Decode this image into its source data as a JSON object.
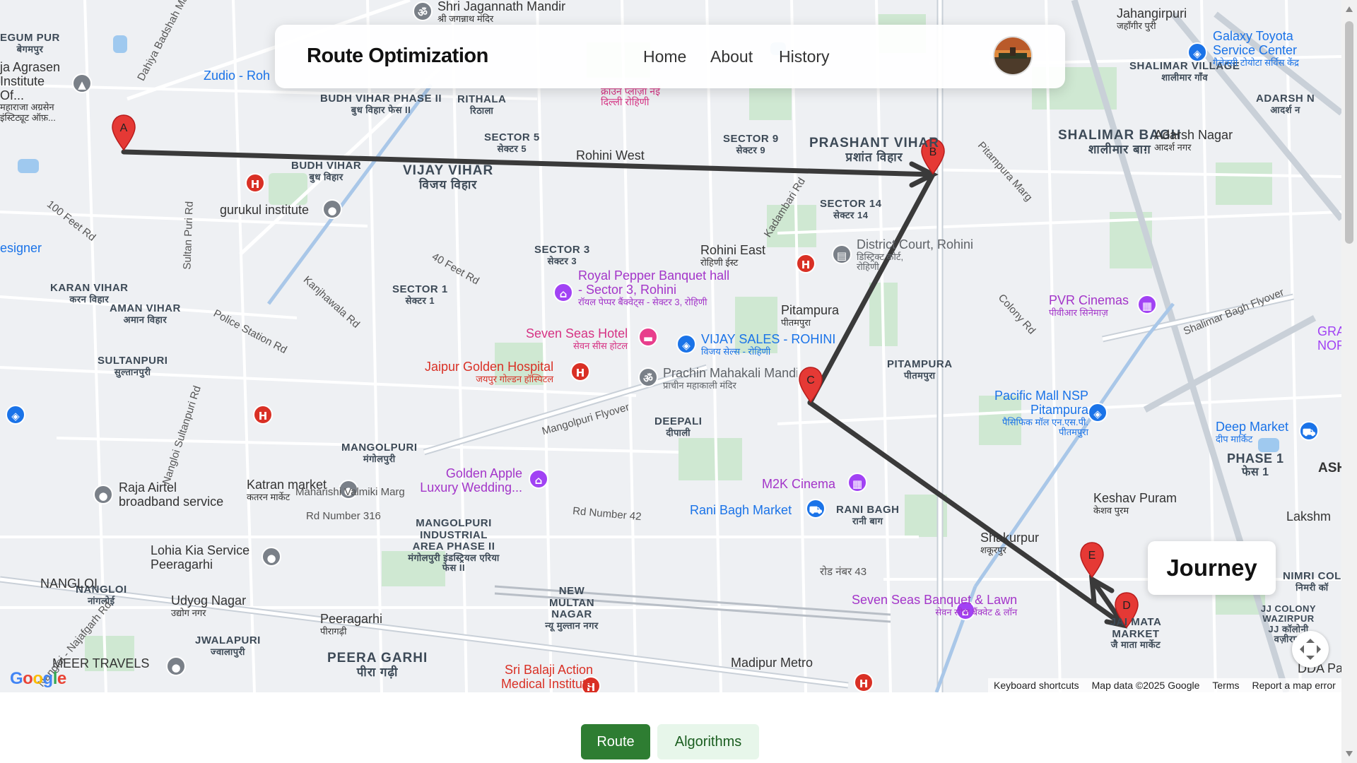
{
  "header": {
    "brand": "Route Optimization",
    "nav": [
      "Home",
      "About",
      "History"
    ]
  },
  "journey_panel": {
    "title": "Journey"
  },
  "tabs": {
    "route": "Route",
    "algorithms": "Algorithms"
  },
  "map": {
    "attribution": [
      "Keyboard shortcuts",
      "Map data ©2025 Google",
      "Terms",
      "Report a map error"
    ],
    "logo": "Google",
    "route_markers": [
      "A",
      "B",
      "C",
      "D",
      "E"
    ],
    "labels": {
      "vijay_vihar": "VIJAY VIHAR",
      "vijay_vihar_hi": "विजय विहार",
      "prashant_vihar": "PRASHANT VIHAR",
      "prashant_vihar_hi": "प्रशांत विहार",
      "shalimar_bagh": "SHALIMAR BAGH",
      "shalimar_bagh_hi": "शालीमार बाग़",
      "peera_garhi": "PEERA GARHI",
      "peera_garhi_hi": "पीरा गढ़ी",
      "mangolpuri_ind": "MANGOLPURI INDUSTRIAL AREA PHASE II",
      "mangolpuri_ind_hi": "मंगोलपुरी इंडस्ट्रियल एरिया फेस II",
      "rohini_west": "Rohini West",
      "rohini_east": "Rohini East",
      "rohini_east_hi": "रोहिणी ईस्ट",
      "pitampura": "Pitampura",
      "pitampura_hi": "पीतमपुरा",
      "pitampura_area": "PITAMPURA",
      "pitampura_area_hi": "पीतमपुरा",
      "gurukul": "gurukul institute",
      "budh_vihar": "BUDH VIHAR",
      "budh_vihar_hi": "बुध विहार",
      "budh_vihar_p2": "BUDH VIHAR PHASE II",
      "budh_vihar_p2_hi": "बुध विहार फेस II",
      "rithala": "RITHALA",
      "rithala_hi": "रिठाला",
      "sector5": "SECTOR 5",
      "sector5_hi": "सेक्टर 5",
      "sector9": "SECTOR 9",
      "sector9_hi": "सेक्टर 9",
      "sector14": "SECTOR 14",
      "sector14_hi": "सेक्टर 14",
      "sector3": "SECTOR 3",
      "sector3_hi": "सेक्टर 3",
      "sector1": "SECTOR 1",
      "sector1_hi": "सेक्टर 1",
      "karan_vihar": "KARAN VIHAR",
      "karan_vihar_hi": "करन विहार",
      "aman_vihar": "AMAN VIHAR",
      "aman_vihar_hi": "अमान विहार",
      "sultanpuri": "SULTANPURI",
      "sultanpuri_hi": "सुल्तानपुरी",
      "mangolpuri": "MANGOLPURI",
      "mangolpuri_hi": "मंगोलपुरी",
      "deepali": "DEEPALI",
      "deepali_hi": "दीपाली",
      "rani_bagh": "RANI BAGH",
      "rani_bagh_hi": "रानी बाग",
      "shakurpur": "Shakurpur",
      "shakurpur_hi": "शकूरपुर",
      "keshav_puram": "Keshav Puram",
      "keshav_puram_hi": "केशव पुरम",
      "phase1": "PHASE 1",
      "phase1_hi": "फेस 1",
      "jai_mata": "JAI MATA MARKET",
      "jai_mata_hi": "जै माता मार्केट",
      "jj_colony": "JJ COLONY WAZIRPUR",
      "jj_colony_hi": "JJ कॉलोनी वज़ीरपुर",
      "new_multan": "NEW MULTAN NAGAR",
      "new_multan_hi": "न्यू मुल्तान नगर",
      "jwalapuri": "JWALAPURI",
      "jwalapuri_hi": "ज्वालापुरी",
      "nangloi": "NANGLOI",
      "nangloi_hi": "नांगलोई",
      "udyog_nagar": "Udyog Nagar",
      "udyog_nagar_hi": "उद्योग नगर",
      "peeragarhi": "Peeragarhi",
      "peeragarhi_hi": "पीरागढ़ी",
      "madipur": "Madipur Metro",
      "adarsh_nagar": "Adarsh Nagar",
      "adarsh_nagar_hi": "आदर्श नगर",
      "jahangirpuri": "Jahangirpuri",
      "jahangirpuri_hi": "जहाँगीर पुरी",
      "shalimar_village": "SHALIMAR VILLAGE",
      "shalimar_village_hi": "शालीमार गाँव",
      "royal_pepper": "Royal Pepper Banquet hall - Sector 3, Rohini",
      "royal_pepper_hi": "रॉयल पेप्पर बैंक्वेट्स - सेक्टर 3, रोहिणी",
      "seven_seas_hotel": "Seven Seas Hotel",
      "seven_seas_hotel_hi": "सेवन सीस होटल",
      "vijay_sales": "VIJAY SALES - ROHINI",
      "vijay_sales_hi": "विजय सेल्स - रोहिणी",
      "jaipur_golden": "Jaipur Golden Hospital",
      "jaipur_golden_hi": "जयपुर गोल्डन हॉस्पिटल",
      "prachin": "Prachin Mahakali Mandir",
      "prachin_hi": "प्राचीन महाकाली मंदिर",
      "district_court": "District Court, Rohini",
      "district_court_hi": "डिस्ट्रिक्ट कोर्ट, रोहिणी",
      "pvr": "PVR Cinemas",
      "pvr_hi": "पीवीआर सिनेमाज़",
      "pacific_mall": "Pacific Mall NSP Pitampura",
      "pacific_mall_hi": "पैसिफिक मॉल एन.एस.पी. पीतमपुरा",
      "deep_market": "Deep Market",
      "deep_market_hi": "दीप मार्किट",
      "m2k": "M2K Cinema",
      "rani_bagh_market": "Rani Bagh Market",
      "golden_apple": "Golden Apple Luxury Wedding...",
      "katran": "Katran market",
      "katran_hi": "कतरन मार्केट",
      "raja_airtel": "Raja Airtel broadband service",
      "lohia": "Lohia Kia Service Peeragarhi",
      "seven_seas_banquet": "Seven Seas Banquet & Lawn",
      "seven_seas_banquet_hi": "सेवन सीज बैंक्वेट & लॉन",
      "sri_balaji": "Sri Balaji Action Medical Institute",
      "meer_travels": "MEER TRAVELS",
      "zudio": "Zudio - Roh",
      "shri_jagannath": "Shri Jagannath Mandir",
      "shri_jagannath_hi": "श्री जगन्नाथ मंदिर",
      "galaxy_toyota": "Galaxy Toyota Service Center",
      "galaxy_toyota_hi": "गैलेक्सी टोयोटा सर्विस केंद्र",
      "agrasen": "ja Agrasen Institute Of...",
      "agrasen_hi": "महाराजा अग्रसेन इंस्टिट्यूट ऑफ़...",
      "crown_plaza_hi": "क्राउन प्लाज़ा नई दिल्ली रोहिणी",
      "esigner": "esigner",
      "maharishi": "Maharishi Valmiki Marg",
      "rd_number_316": "Rd Number 316",
      "rd_number_42": "Rd Number 42",
      "road_43": "रोड नंबर 43",
      "mangolpuri_flyover": "Mangolpuri Flyover",
      "shalimar_flyover": "Shalimar Bagh Flyover",
      "police_station": "Police Station Rd",
      "kanjhawala": "Kanjhawala Rd",
      "sultan_puri": "Sultan Puri Rd",
      "rd_40_feet": "40 Feet Rd",
      "rd_100_feet": "100 Feet Rd",
      "colony_rd": "Colony Rd",
      "kadambari": "Kadambari Rd",
      "pitampura_marg": "Pitampura Marg",
      "nangloi_sultanpuri": "Nangloi Sultanpuri Rd",
      "najafgarh": "Nangloi - Najafgarh Rd",
      "dahiya": "Dahiya Badshah Marg",
      "rohini_west_metro": "Rohini West",
      "gran_north": "GRAN NORTH",
      "ashok": "ASHO",
      "lakshmi": "Lakshm",
      "dda": "DDA Pa",
      "nimri": "NIMRI COL",
      "nimri_hi": "निमरी कॉ",
      "adarsh_n2": "ADARSH N",
      "adarsh_n2_hi": "आदर्श न",
      "egum_pur": "EGUM PUR",
      "egum_pur_hi": "बेगमपुर"
    }
  }
}
